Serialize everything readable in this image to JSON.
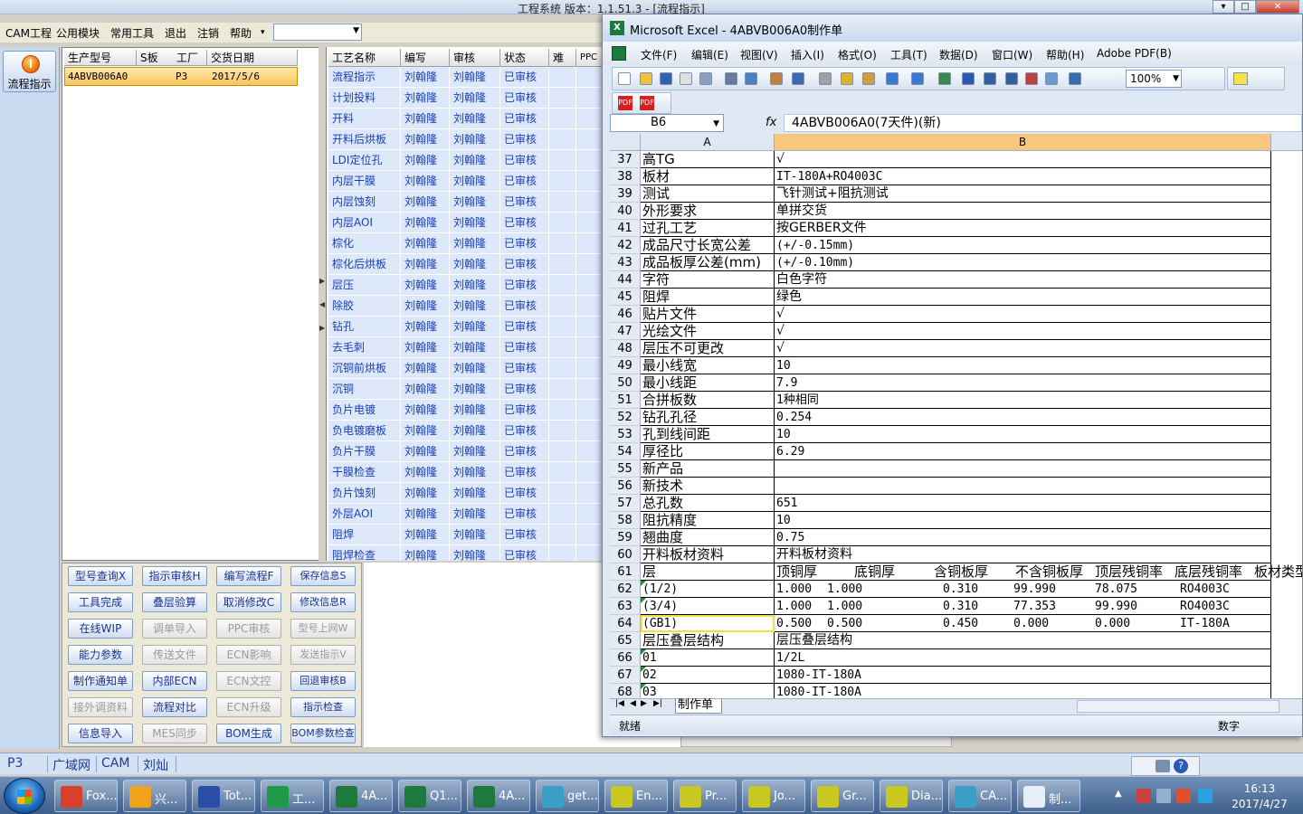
{
  "background_app": {
    "title": "工程系统   版本：1.1.51.3 - [流程指示]",
    "menu": [
      "CAM工程",
      "公用模块",
      "常用工具",
      "退出",
      "注销",
      "帮助"
    ],
    "window_buttons": [
      "▾",
      "□",
      "✕"
    ]
  },
  "left_nav": {
    "flow_button_label": "流程指示"
  },
  "product_grid": {
    "columns": [
      "生产型号",
      "S板",
      "工厂",
      "交货日期"
    ],
    "row": [
      "4ABVB006A0",
      "",
      "P3",
      "2017/5/6"
    ]
  },
  "process_grid": {
    "columns": [
      "工艺名称",
      "编写",
      "审核",
      "状态",
      "难",
      "PPC"
    ],
    "rows": [
      [
        "流程指示",
        "刘翰隆",
        "刘翰隆",
        "已审核"
      ],
      [
        "计划投料",
        "刘翰隆",
        "刘翰隆",
        "已审核"
      ],
      [
        "开料",
        "刘翰隆",
        "刘翰隆",
        "已审核"
      ],
      [
        "开料后烘板",
        "刘翰隆",
        "刘翰隆",
        "已审核"
      ],
      [
        "LDI定位孔",
        "刘翰隆",
        "刘翰隆",
        "已审核"
      ],
      [
        "内层干膜",
        "刘翰隆",
        "刘翰隆",
        "已审核"
      ],
      [
        "内层蚀刻",
        "刘翰隆",
        "刘翰隆",
        "已审核"
      ],
      [
        "内层AOI",
        "刘翰隆",
        "刘翰隆",
        "已审核"
      ],
      [
        "棕化",
        "刘翰隆",
        "刘翰隆",
        "已审核"
      ],
      [
        "棕化后烘板",
        "刘翰隆",
        "刘翰隆",
        "已审核"
      ],
      [
        "层压",
        "刘翰隆",
        "刘翰隆",
        "已审核"
      ],
      [
        "除胶",
        "刘翰隆",
        "刘翰隆",
        "已审核"
      ],
      [
        "钻孔",
        "刘翰隆",
        "刘翰隆",
        "已审核"
      ],
      [
        "去毛刺",
        "刘翰隆",
        "刘翰隆",
        "已审核"
      ],
      [
        "沉铜前烘板",
        "刘翰隆",
        "刘翰隆",
        "已审核"
      ],
      [
        "沉铜",
        "刘翰隆",
        "刘翰隆",
        "已审核"
      ],
      [
        "负片电镀",
        "刘翰隆",
        "刘翰隆",
        "已审核"
      ],
      [
        "负电镀磨板",
        "刘翰隆",
        "刘翰隆",
        "已审核"
      ],
      [
        "负片干膜",
        "刘翰隆",
        "刘翰隆",
        "已审核"
      ],
      [
        "干膜检查",
        "刘翰隆",
        "刘翰隆",
        "已审核"
      ],
      [
        "负片蚀刻",
        "刘翰隆",
        "刘翰隆",
        "已审核"
      ],
      [
        "外层AOI",
        "刘翰隆",
        "刘翰隆",
        "已审核"
      ],
      [
        "阻焊",
        "刘翰隆",
        "刘翰隆",
        "已审核"
      ],
      [
        "阻焊检查",
        "刘翰隆",
        "刘翰隆",
        "已审核"
      ]
    ]
  },
  "function_buttons": [
    [
      {
        "label": "型号查询X",
        "enabled": true
      },
      {
        "label": "指示审核H",
        "enabled": true
      },
      {
        "label": "编写流程F",
        "enabled": true
      },
      {
        "label": "保存信息S",
        "enabled": true
      }
    ],
    [
      {
        "label": "工具完成",
        "enabled": true
      },
      {
        "label": "叠层验算",
        "enabled": true
      },
      {
        "label": "取消修改C",
        "enabled": true
      },
      {
        "label": "修改信息R",
        "enabled": true
      }
    ],
    [
      {
        "label": "在线WIP",
        "enabled": true
      },
      {
        "label": "调单导入",
        "enabled": false
      },
      {
        "label": "PPC审核",
        "enabled": false
      },
      {
        "label": "型号上网W",
        "enabled": false
      }
    ],
    [
      {
        "label": "能力参数",
        "enabled": true
      },
      {
        "label": "传送文件",
        "enabled": false
      },
      {
        "label": "ECN影响",
        "enabled": false
      },
      {
        "label": "发送指示V",
        "enabled": false
      }
    ],
    [
      {
        "label": "制作通知单",
        "enabled": true
      },
      {
        "label": "内部ECN",
        "enabled": true
      },
      {
        "label": "ECN文控",
        "enabled": false
      },
      {
        "label": "回退审核B",
        "enabled": true
      }
    ],
    [
      {
        "label": "接外调资料",
        "enabled": false
      },
      {
        "label": "流程对比",
        "enabled": true
      },
      {
        "label": "ECN升级",
        "enabled": false
      },
      {
        "label": "指示检查",
        "enabled": true
      }
    ],
    [
      {
        "label": "信息导入",
        "enabled": true
      },
      {
        "label": "MES同步",
        "enabled": false
      },
      {
        "label": "BOM生成",
        "enabled": true
      },
      {
        "label": "BOM参数检查",
        "enabled": true
      }
    ]
  ],
  "status_strip": [
    "P3",
    "广域网",
    "CAM",
    "刘灿"
  ],
  "excel": {
    "title": "Microsoft Excel - 4ABVB006A0制作单",
    "menu": [
      "文件(F)",
      "编辑(E)",
      "视图(V)",
      "插入(I)",
      "格式(O)",
      "工具(T)",
      "数据(D)",
      "窗口(W)",
      "帮助(H)",
      "Adobe PDF(B)"
    ],
    "zoom": "100%",
    "name_box": "B6",
    "formula_label": "fx",
    "formula_content": "4ABVB006A0(7天件)(新)",
    "column_headers": [
      "A",
      "B"
    ],
    "rows": [
      {
        "n": "37",
        "a": "高TG",
        "b": "√"
      },
      {
        "n": "38",
        "a": "板材",
        "b": "IT-180A+RO4003C"
      },
      {
        "n": "39",
        "a": "测试",
        "b": "飞针测试+阻抗测试"
      },
      {
        "n": "40",
        "a": "外形要求",
        "b": "单拼交货"
      },
      {
        "n": "41",
        "a": "过孔工艺",
        "b": "按GERBER文件"
      },
      {
        "n": "42",
        "a": "成品尺寸长宽公差",
        "b": "(+/-0.15mm)"
      },
      {
        "n": "43",
        "a": "成品板厚公差(mm)",
        "b": "(+/-0.10mm)"
      },
      {
        "n": "44",
        "a": "字符",
        "b": "白色字符"
      },
      {
        "n": "45",
        "a": "阻焊",
        "b": "绿色"
      },
      {
        "n": "46",
        "a": "贴片文件",
        "b": "√"
      },
      {
        "n": "47",
        "a": "光绘文件",
        "b": "√"
      },
      {
        "n": "48",
        "a": "层压不可更改",
        "b": "√"
      },
      {
        "n": "49",
        "a": "最小线宽",
        "b": "10"
      },
      {
        "n": "50",
        "a": "最小线距",
        "b": "7.9"
      },
      {
        "n": "51",
        "a": "合拼板数",
        "b": "1种相同"
      },
      {
        "n": "52",
        "a": "钻孔孔径",
        "b": "0.254"
      },
      {
        "n": "53",
        "a": "孔到线间距",
        "b": "10"
      },
      {
        "n": "54",
        "a": "厚径比",
        "b": "6.29"
      },
      {
        "n": "55",
        "a": "新产品",
        "b": ""
      },
      {
        "n": "56",
        "a": "新技术",
        "b": ""
      },
      {
        "n": "57",
        "a": "总孔数",
        "b": "651"
      },
      {
        "n": "58",
        "a": "阻抗精度",
        "b": "10"
      },
      {
        "n": "59",
        "a": "翘曲度",
        "b": "0.75"
      },
      {
        "n": "60",
        "a": "开料板材资料",
        "b": "开料板材资料"
      }
    ],
    "stack_header_row": {
      "n": "61",
      "a": "层",
      "cols": [
        "顶铜厚",
        "底铜厚",
        "含铜板厚",
        "不含铜板厚",
        "顶层残铜率",
        "底层残铜率",
        "板材类型"
      ]
    },
    "stack_rows": [
      {
        "n": "62",
        "a": "(1/2)",
        "vals": [
          "1.000",
          "1.000",
          "",
          "0.310",
          "99.990",
          "78.075",
          "RO4003C"
        ]
      },
      {
        "n": "63",
        "a": "(3/4)",
        "vals": [
          "1.000",
          "1.000",
          "",
          "0.310",
          "77.353",
          "99.990",
          "RO4003C"
        ]
      },
      {
        "n": "64",
        "a": "(GB1)",
        "vals": [
          "0.500",
          "0.500",
          "",
          "0.450",
          "0.000",
          "0.000",
          "IT-180A"
        ]
      }
    ],
    "tail_rows": [
      {
        "n": "65",
        "a": "层压叠层结构",
        "b": "层压叠层结构"
      },
      {
        "n": "66",
        "a": "01",
        "b": "1/2L"
      },
      {
        "n": "67",
        "a": "02",
        "b": "1080-IT-180A"
      },
      {
        "n": "68",
        "a": "03",
        "b": "1080-IT-180A"
      }
    ],
    "sheet_tab": "制作单",
    "status_left": "就绪",
    "status_right": "数字"
  },
  "taskbar": {
    "items": [
      {
        "label": "Fox...",
        "color": "#d8402a"
      },
      {
        "label": "兴...",
        "color": "#f2a31c"
      },
      {
        "label": "Tot...",
        "color": "#2a4ea8"
      },
      {
        "label": "工...",
        "color": "#1e9a4a"
      },
      {
        "label": "4A...",
        "color": "#1e7a3c"
      },
      {
        "label": "Q1...",
        "color": "#1e7a3c"
      },
      {
        "label": "4A...",
        "color": "#1e7a3c"
      },
      {
        "label": "get...",
        "color": "#3aa0c8"
      },
      {
        "label": "En...",
        "color": "#c8c820"
      },
      {
        "label": "Pr...",
        "color": "#c8c820"
      },
      {
        "label": "Jo...",
        "color": "#c8c820"
      },
      {
        "label": "Gr...",
        "color": "#c8c820"
      },
      {
        "label": "Dia...",
        "color": "#c8c820"
      },
      {
        "label": "CA...",
        "color": "#3aa0c8"
      },
      {
        "label": "制...",
        "color": "#e8eef8"
      }
    ],
    "time": "16:13",
    "date": "2017/4/27"
  }
}
